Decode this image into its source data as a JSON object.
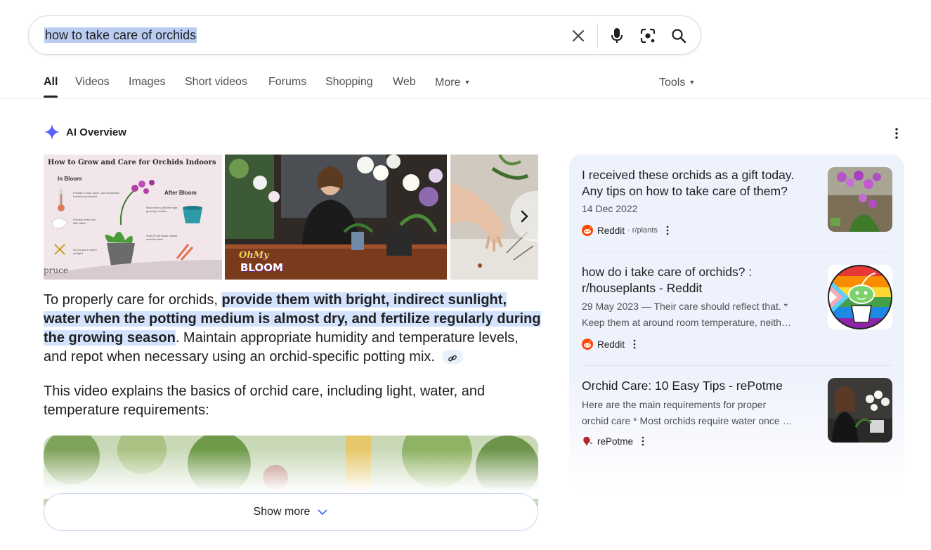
{
  "search": {
    "query": "how to take care of orchids"
  },
  "tabs": [
    {
      "label": "All",
      "active": true
    },
    {
      "label": "Videos"
    },
    {
      "label": "Images"
    },
    {
      "label": "Short videos"
    },
    {
      "label": "Forums"
    },
    {
      "label": "Shopping"
    },
    {
      "label": "Web"
    },
    {
      "label": "More"
    }
  ],
  "tools_label": "Tools",
  "ai_overview": {
    "title": "AI Overview",
    "images": [
      {
        "heading": "How to Grow and Care for Orchids Indoors",
        "in_bloom": "In Bloom",
        "after_bloom": "After Bloom",
        "notes": [
          "Provide a mild, warm, and somewhat humid environment",
          "Orchids need very little water",
          "Do not put in direct sunlight",
          "Repot them with the right growing medium",
          "Snip off old flower spikes near the base"
        ],
        "credit": "pruce"
      },
      {
        "logo_line1": "OhMy",
        "logo_line2": "BLOOM"
      },
      {}
    ],
    "text_plain_1": "To properly care for orchids, ",
    "text_highlight": "provide them with bright, indirect sunlight, water when the potting medium is almost dry, and fertilize regularly during the growing season",
    "text_plain_2": ". Maintain appropriate humidity and temperature levels, and repot when necessary using an orchid-specific potting mix.",
    "video_intro": "This video explains the basics of orchid care, including light, water, and temperature requirements:",
    "show_more": "Show more"
  },
  "sources": [
    {
      "title": "I received these orchids as a gift today. Any tips on how to take care of them?",
      "meta": "14 Dec 2022",
      "site": "Reddit",
      "site_sub": "· r/plants",
      "icon": "reddit-icon"
    },
    {
      "title": "how do i take care of orchids? : r/houseplants - Reddit",
      "meta1": "29 May 2023 — Their care should reflect that. *",
      "meta2": "Keep them at around room temperature, neith…",
      "site": "Reddit",
      "icon": "reddit-icon"
    },
    {
      "title": "Orchid Care: 10 Easy Tips - rePotme",
      "meta1": "Here are the main requirements for proper",
      "meta2": "orchid care * Most orchids require water once …",
      "site": "rePotme",
      "icon": "repotme-icon"
    }
  ],
  "colors": {
    "highlight": "#d3e3fd",
    "panel": "#eef2fc",
    "reddit": "#ff4500",
    "ai_star": "#4b6cf6"
  }
}
